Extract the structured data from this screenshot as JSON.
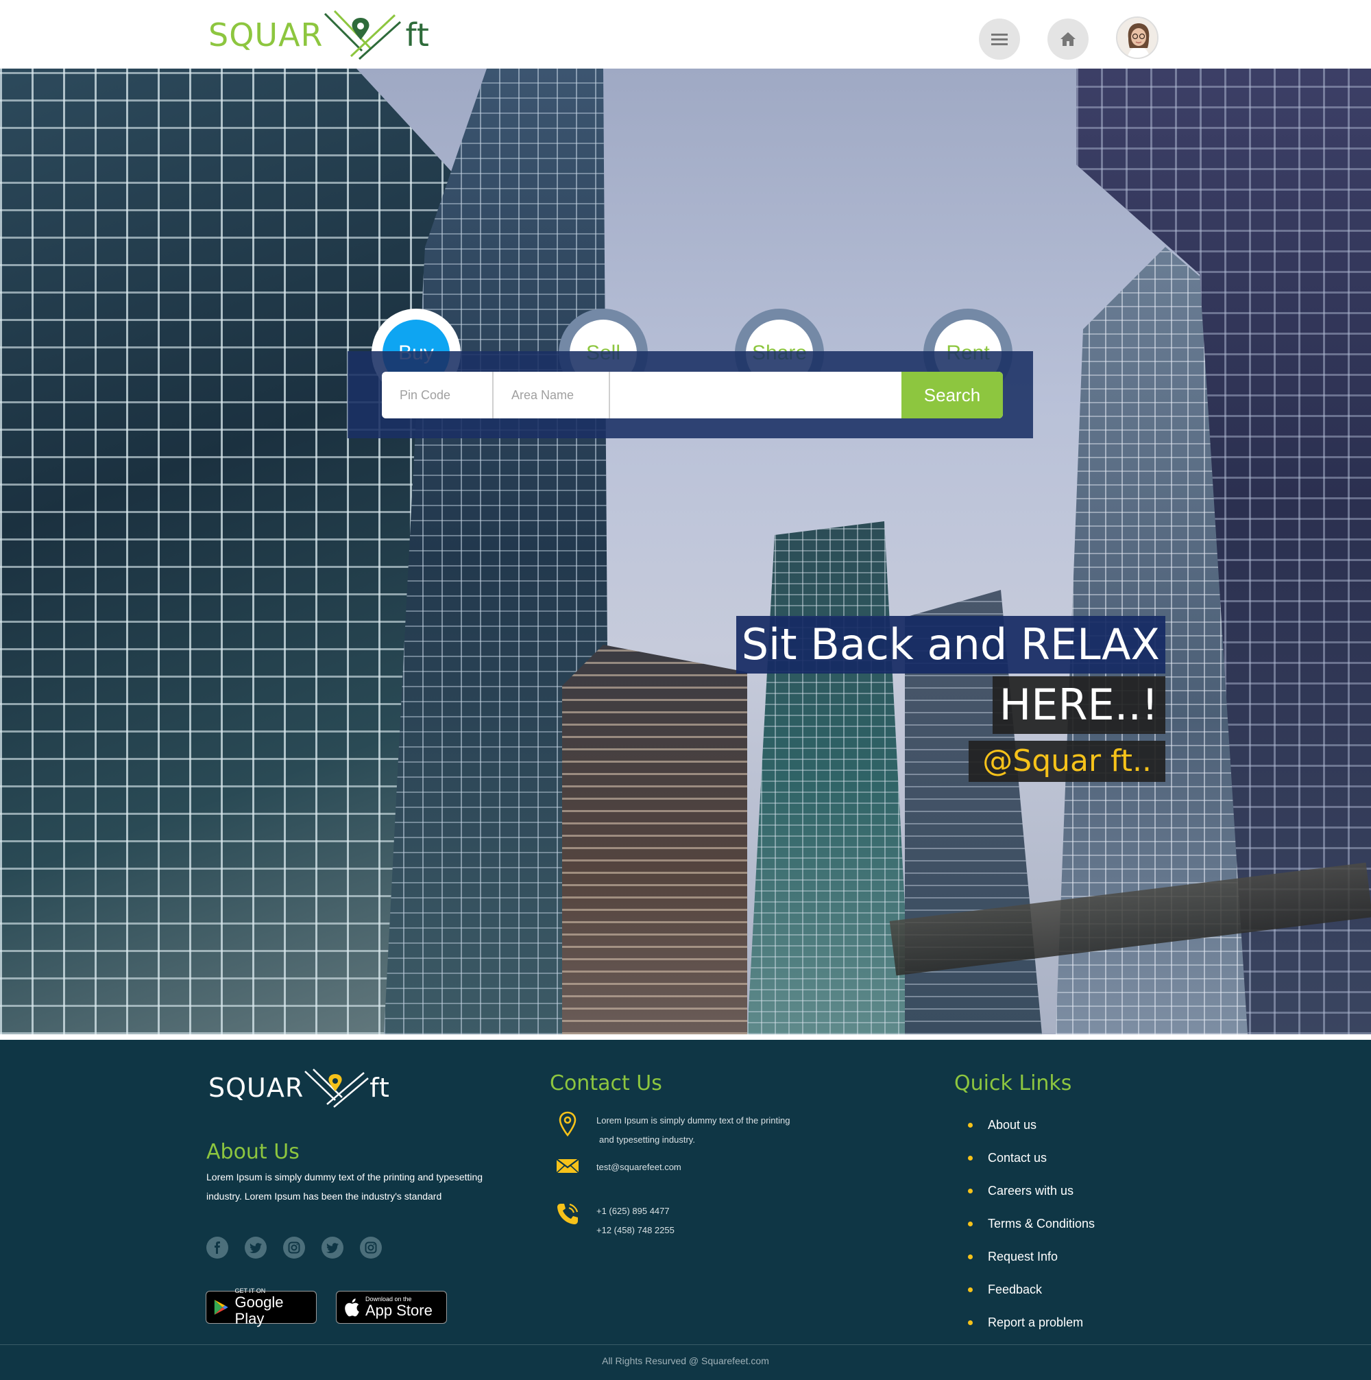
{
  "header": {
    "logo_left": "SQUAR",
    "logo_right": "ft"
  },
  "hero": {
    "tabs": [
      {
        "label": "Buy",
        "active": true
      },
      {
        "label": "Sell",
        "active": false
      },
      {
        "label": "Share",
        "active": false
      },
      {
        "label": "Rent",
        "active": false
      }
    ],
    "search": {
      "pin_placeholder": "Pin Code",
      "area_placeholder": "Area Name",
      "query_value": "",
      "button_label": "Search"
    },
    "tagline": {
      "line1": "Sit Back and RELAX",
      "line2": "HERE..!",
      "line3": "@Squar ft.."
    }
  },
  "footer": {
    "logo_left": "SQUAR",
    "logo_right": "ft",
    "about": {
      "heading": "About Us",
      "text": "Lorem Ipsum is simply dummy text of the printing and typesetting industry. Lorem Ipsum has been the industry's standard"
    },
    "socials": [
      "facebook-icon",
      "twitter-icon",
      "instagram-icon",
      "twitter-icon",
      "instagram-icon"
    ],
    "stores": {
      "google_small": "GET IT ON",
      "google_big": "Google Play",
      "apple_small": "Download on the",
      "apple_big": "App Store"
    },
    "contact": {
      "heading": "Contact Us",
      "address_line1": "Lorem Ipsum is simply dummy text of the printing",
      "address_line2": "and typesetting industry.",
      "email": "test@squarefeet.com",
      "phone1": "+1 (625) 895 4477",
      "phone2": "+12 (458) 748 2255"
    },
    "quick_links": {
      "heading": "Quick Links",
      "items": [
        "About us",
        "Contact us",
        "Careers with us",
        "Terms & Conditions",
        "Request Info",
        "Feedback",
        "Report a problem"
      ]
    },
    "copyright": "All Rights Resurved @ Squarefeet.com"
  },
  "colors": {
    "brand_green": "#8dc63f",
    "active_blue": "#0ea5f2",
    "footer_bg": "#0f3645",
    "accent_yellow": "#f6c21a",
    "panel_navy": "#1a3064"
  }
}
